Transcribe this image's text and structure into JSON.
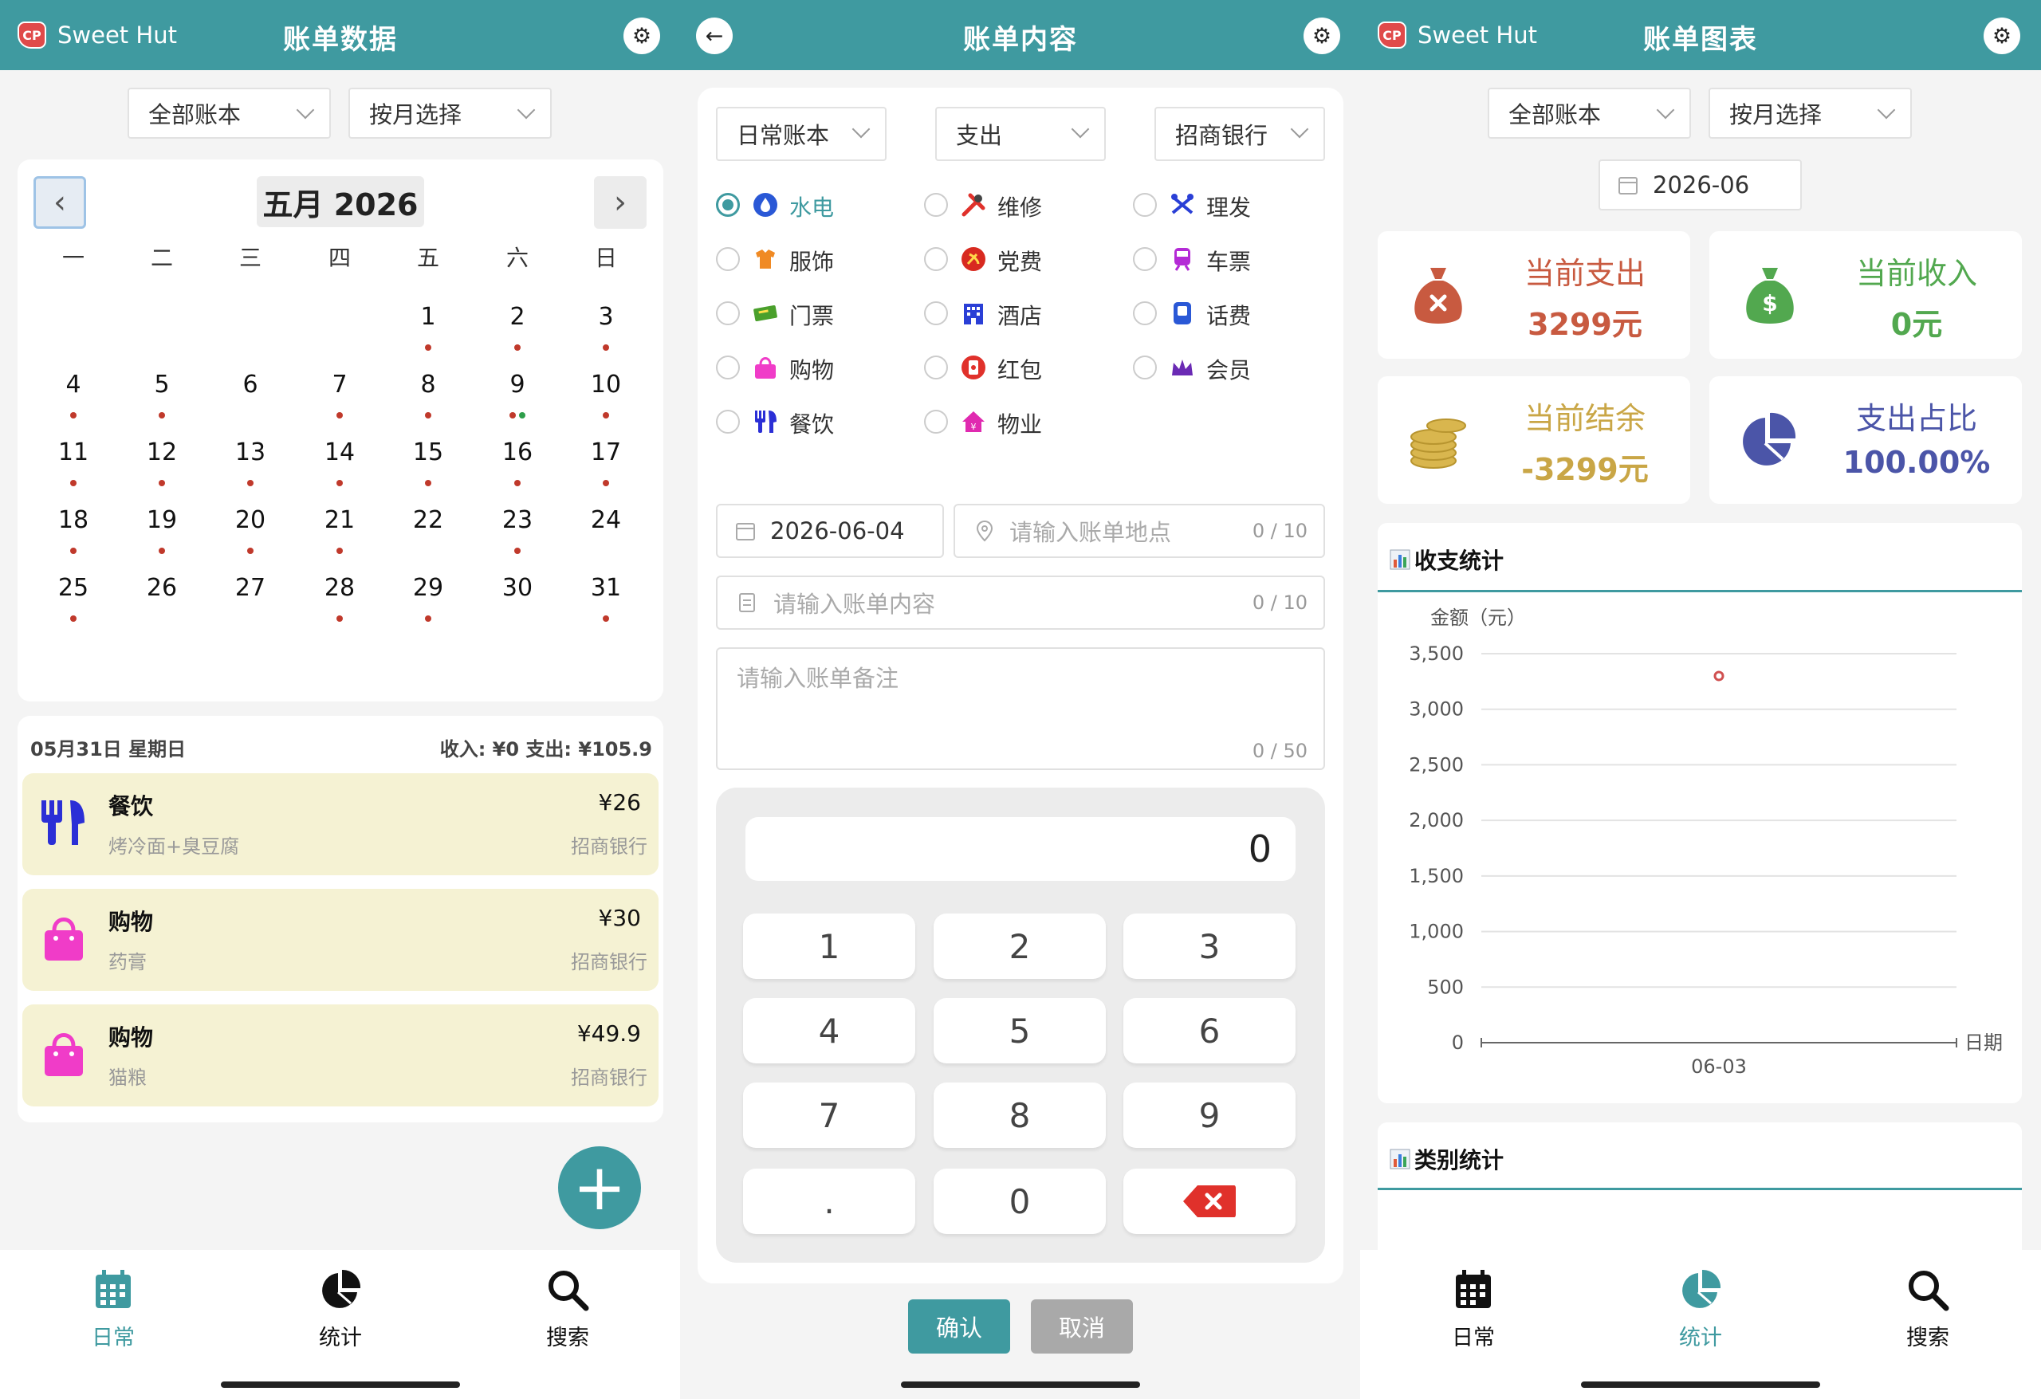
{
  "colors": {
    "accent": "#3f9aa0",
    "expense": "#c85a40",
    "income": "#52a84f",
    "balance": "#c9a646",
    "ratio": "#4b55a8",
    "dot_red": "#c0392b",
    "dot_green": "#2e9e4a"
  },
  "panel_daily": {
    "brand": "Sweet Hut",
    "title": "账单数据",
    "filters": [
      "全部账本",
      "按月选择"
    ],
    "calendar": {
      "month_label": "五月 2026",
      "weekdays": [
        "一",
        "二",
        "三",
        "四",
        "五",
        "六",
        "日"
      ],
      "weeks": [
        [
          "",
          "",
          "",
          "",
          "1",
          "2",
          "3"
        ],
        [
          "4",
          "5",
          "6",
          "7",
          "8",
          "9",
          "10"
        ],
        [
          "11",
          "12",
          "13",
          "14",
          "15",
          "16",
          "17"
        ],
        [
          "18",
          "19",
          "20",
          "21",
          "22",
          "23",
          "24"
        ],
        [
          "25",
          "26",
          "27",
          "28",
          "29",
          "30",
          "31"
        ]
      ]
    },
    "day_summary": {
      "date": "05月31日 星期日",
      "totals": "收入: ¥0  支出: ¥105.9"
    },
    "records": [
      {
        "category": "餐饮",
        "note": "烤冷面+臭豆腐",
        "amount": "¥26",
        "bank": "招商银行",
        "icon": "utensils-icon"
      },
      {
        "category": "购物",
        "note": "药膏",
        "amount": "¥30",
        "bank": "招商银行",
        "icon": "shopping-bag-icon"
      },
      {
        "category": "购物",
        "note": "猫粮",
        "amount": "¥49.9",
        "bank": "招商银行",
        "icon": "shopping-bag-icon"
      }
    ],
    "tabs": [
      "日常",
      "统计",
      "搜索"
    ]
  },
  "panel_edit": {
    "title": "账单内容",
    "selects": [
      "日常账本",
      "支出",
      "招商银行"
    ],
    "categories": [
      [
        "水电",
        "维修",
        "理发"
      ],
      [
        "服饰",
        "党费",
        "车票"
      ],
      [
        "门票",
        "酒店",
        "话费"
      ],
      [
        "购物",
        "红包",
        "会员"
      ],
      [
        "餐饮",
        "物业",
        ""
      ]
    ],
    "selected_category": "水电",
    "date": "2026-06-04",
    "location_placeholder": "请输入账单地点",
    "location_count": "0 / 10",
    "content_placeholder": "请输入账单内容",
    "content_count": "0 / 10",
    "remark_placeholder": "请输入账单备注",
    "remark_count": "0 / 50",
    "display_value": "0",
    "keys": [
      "1",
      "2",
      "3",
      "4",
      "5",
      "6",
      "7",
      "8",
      "9",
      ".",
      "0"
    ],
    "confirm": "确认",
    "cancel": "取消"
  },
  "panel_stats": {
    "brand": "Sweet Hut",
    "title": "账单图表",
    "filters": [
      "全部账本",
      "按月选择"
    ],
    "month": "2026-06",
    "cards": [
      {
        "label": "当前支出",
        "value": "3299元"
      },
      {
        "label": "当前收入",
        "value": "0元"
      },
      {
        "label": "当前结余",
        "value": "-3299元"
      },
      {
        "label": "支出占比",
        "value": "100.00%"
      }
    ],
    "section_income_expense": "收支统计",
    "section_category": "类别统计",
    "tabs": [
      "日常",
      "统计",
      "搜索"
    ]
  },
  "chart_data": {
    "type": "scatter",
    "ylabel": "金额（元）",
    "xlabel": "日期",
    "y_ticks": [
      "3,500",
      "3,000",
      "2,500",
      "2,000",
      "1,500",
      "1,000",
      "500",
      "0"
    ],
    "ylim": [
      0,
      3500
    ],
    "x": [
      "06-03"
    ],
    "values": [
      3299
    ],
    "grid": true
  }
}
